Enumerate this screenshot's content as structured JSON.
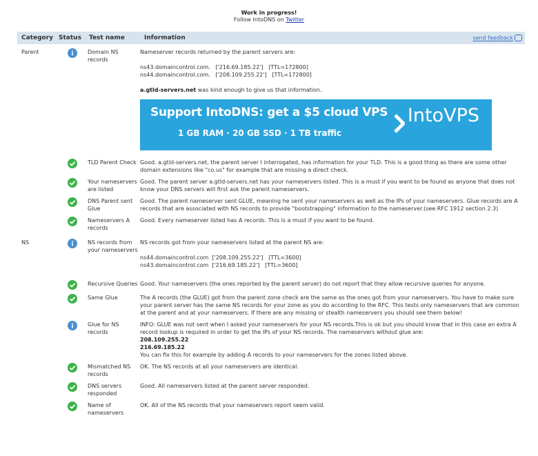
{
  "header": {
    "wip": "Work in progress!",
    "follow_prefix": "Follow IntoDNS on",
    "twitter": "Twitter"
  },
  "table": {
    "columns": [
      "Category",
      "Status",
      "Test name",
      "Information"
    ],
    "feedback": "send feedback"
  },
  "rows": {
    "r1": {
      "category": "Parent",
      "test": "Domain NS records",
      "intro": "Nameserver records returned by the parent servers are:",
      "ns1": "ns43.domaincontrol.com.   ['216.69.185.22']   [TTL=172800]",
      "ns2": "ns44.domaincontrol.com.   ['208.109.255.22']   [TTL=172800]",
      "gtld_bold": "a.gtld-servers.net",
      "gtld_rest": " was kind enough to give us that information."
    },
    "r2": {
      "test": "TLD Parent Check",
      "info": "Good. a.gtld-servers.net, the parent server I interrogated, has information for your TLD. This is a good thing as there are some other domain extensions like \"co.us\" for example that are missing a direct check."
    },
    "r3": {
      "test": "Your nameservers are listed",
      "info": "Good. The parent server a.gtld-servers.net has your nameservers listed. This is a must if you want to be found as anyone that does not know your DNS servers will first ask the parent nameservers."
    },
    "r4": {
      "test": "DNS Parent sent Glue",
      "info": "Good. The parent nameserver sent GLUE, meaning he sent your nameservers as well as the IPs of your nameservers. Glue records are A records that are associated with NS records to provide \"bootstrapping\" information to the nameserver.(see RFC 1912 section 2.3)"
    },
    "r5": {
      "test": "Nameservers A records",
      "info": "Good. Every nameserver listed has A records. This is a must if you want to be found."
    },
    "r6": {
      "category": "NS",
      "test": "NS records from your nameservers",
      "intro": "NS records got from your nameservers listed at the parent NS are:",
      "ns1": "ns44.domaincontrol.com  ['208.109.255.22']   [TTL=3600]",
      "ns2": "ns43.domaincontrol.com  ['216.69.185.22']   [TTL=3600]"
    },
    "r7": {
      "test": "Recursive Queries",
      "info": "Good. Your nameservers (the ones reported by the parent server) do not report that they allow recursive queries for anyone."
    },
    "r8": {
      "test": "Same Glue",
      "info": "The A records (the GLUE) got from the parent zone check are the same as the ones got from your nameservers. You have to make sure your parent server has the same NS records for your zone as you do according to the RFC. This tests only nameservers that are common at the parent and at your nameservers. If there are any missing or stealth nameservers you should see them below!"
    },
    "r9": {
      "test": "Glue for NS records",
      "info": "INFO: GLUE was not sent when I asked your nameservers for your NS records.This is ok but you should know that in this case an extra A record lookup is required in order to get the IPs of your NS records. The nameservers without glue are:",
      "ip1": "208.109.255.22",
      "ip2": "216.69.185.22",
      "fix": "You can fix this for example by adding A records to your nameservers for the zones listed above."
    },
    "r10": {
      "test": "Mismatched NS records",
      "info": "OK. The NS records at all your nameservers are identical."
    },
    "r11": {
      "test": "DNS servers responded",
      "info": "Good. All nameservers listed at the parent server responded."
    },
    "r12": {
      "test": "Name of nameservers",
      "info": "OK. All of the NS records that your nameservers report seem valid."
    }
  },
  "ad": {
    "headline": "Support IntoDNS: get a $5 cloud VPS",
    "specs": "1 GB RAM · 20 GB SSD · 1 TB traffic",
    "logo": "IntoVPS",
    "bg": "#2aa4dc"
  },
  "colors": {
    "header_bg": "#d7e4ee",
    "ok": "#3cb34a",
    "info": "#4a8fd1"
  }
}
